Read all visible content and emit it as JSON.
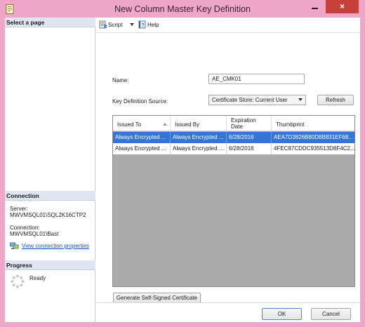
{
  "window": {
    "title": "New Column Master Key Definition"
  },
  "sidebar": {
    "select_page_header": "Select a page",
    "connection_header": "Connection",
    "server_label": "Server:",
    "server_value": "MWVMSQL01\\SQL2K16CTP2",
    "connection_label": "Connection:",
    "connection_value": "MWVMSQL01\\Bast",
    "view_connection_link": "View connection properties",
    "progress_header": "Progress",
    "progress_status": "Ready"
  },
  "toolbar": {
    "script_label": "Script",
    "help_label": "Help"
  },
  "form": {
    "name_label": "Name:",
    "name_value": "AE_CMK01",
    "source_label": "Key Definition Source:",
    "source_selected": "Certificate Store: Current User",
    "refresh_label": "Refresh",
    "generate_label": "Generate Self-Signed Certificate"
  },
  "grid": {
    "columns": {
      "issued_to": "Issued To",
      "issued_by": "Issued By",
      "expiration_line1": "Expiration",
      "expiration_line2": "Date",
      "thumbprint": "Thumbprint"
    },
    "rows": [
      {
        "issued_to": "Always Encrypted ...",
        "issued_by": "Always Encrypted ...",
        "expiration": "6/28/2016",
        "thumbprint": "AEA7D3826B80D8B831EF68..."
      },
      {
        "issued_to": "Always Encrypted ...",
        "issued_by": "Always Encrypted ...",
        "expiration": "6/28/2016",
        "thumbprint": "4FEC87CDDC935513D8F4C2..."
      }
    ]
  },
  "footer": {
    "ok_label": "OK",
    "cancel_label": "Cancel"
  },
  "icons": {
    "close": "×"
  },
  "colors": {
    "titlebar": "#f0a6c8",
    "selection": "#3376d4",
    "link": "#1d4fb8",
    "close_button": "#c7413a"
  }
}
